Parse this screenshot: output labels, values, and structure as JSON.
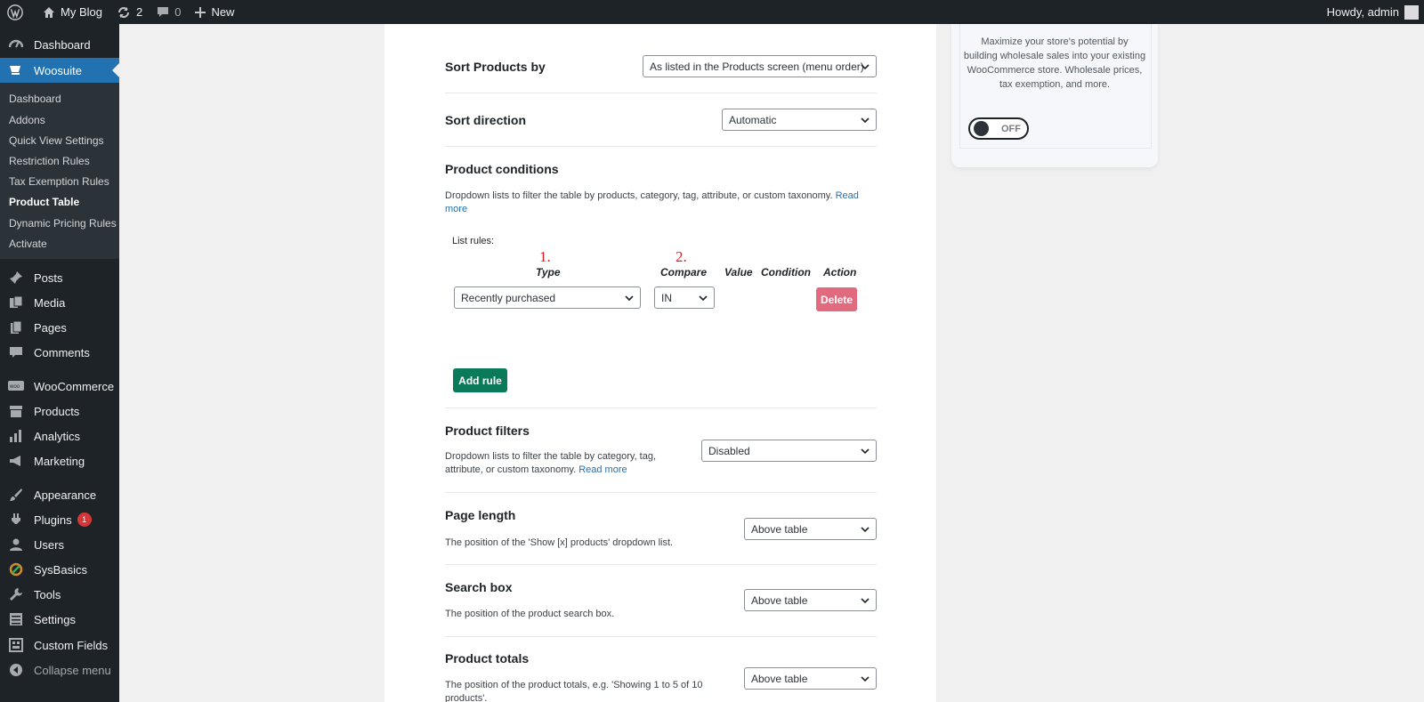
{
  "admin_bar": {
    "site_name": "My Blog",
    "updates_count": "2",
    "comments_count": "0",
    "new_label": "New",
    "greeting": "Howdy, admin"
  },
  "sidebar": {
    "dashboard": "Dashboard",
    "woosuite": "Woosuite",
    "submenu": [
      "Dashboard",
      "Addons",
      "Quick View Settings",
      "Restriction Rules",
      "Tax Exemption Rules",
      "Product Table",
      "Dynamic Pricing Rules",
      "Activate"
    ],
    "posts": "Posts",
    "media": "Media",
    "pages": "Pages",
    "comments": "Comments",
    "woocommerce": "WooCommerce",
    "products": "Products",
    "analytics": "Analytics",
    "marketing": "Marketing",
    "appearance": "Appearance",
    "plugins": "Plugins",
    "plugins_badge": "1",
    "users": "Users",
    "sysbasics": "SysBasics",
    "tools": "Tools",
    "settings": "Settings",
    "custom_fields": "Custom Fields",
    "collapse": "Collapse menu"
  },
  "settings": {
    "sort_products": {
      "title": "Sort Products by",
      "value": "As listed in the Products screen (menu order)"
    },
    "sort_direction": {
      "title": "Sort direction",
      "value": "Automatic"
    },
    "product_conditions": {
      "title": "Product conditions",
      "desc": "Dropdown lists to filter the table by products, category, tag, attribute, or custom taxonomy.",
      "read_more": "Read more",
      "list_rules_label": "List rules:",
      "annot_1": "1.",
      "annot_2": "2.",
      "headers": {
        "type": "Type",
        "compare": "Compare",
        "value": "Value",
        "condition": "Condition",
        "action": "Action"
      },
      "rule": {
        "type": "Recently purchased",
        "compare": "IN"
      },
      "delete_label": "Delete",
      "add_rule_label": "Add rule"
    },
    "product_filters": {
      "title": "Product filters",
      "desc": "Dropdown lists to filter the table by category, tag, attribute, or custom taxonomy.",
      "read_more": "Read more",
      "value": "Disabled"
    },
    "page_length": {
      "title": "Page length",
      "desc": "The position of the 'Show [x] products' dropdown list.",
      "value": "Above table"
    },
    "search_box": {
      "title": "Search box",
      "desc": "The position of the product search box.",
      "value": "Above table"
    },
    "product_totals": {
      "title": "Product totals",
      "desc": "The position of the product totals, e.g. 'Showing 1 to 5 of 10 products'.",
      "value": "Above table"
    }
  },
  "promo": {
    "text": "Maximize your store's potential by building wholesale sales into your existing WooCommerce store. Wholesale prices, tax exemption, and more.",
    "toggle_label": "OFF"
  }
}
